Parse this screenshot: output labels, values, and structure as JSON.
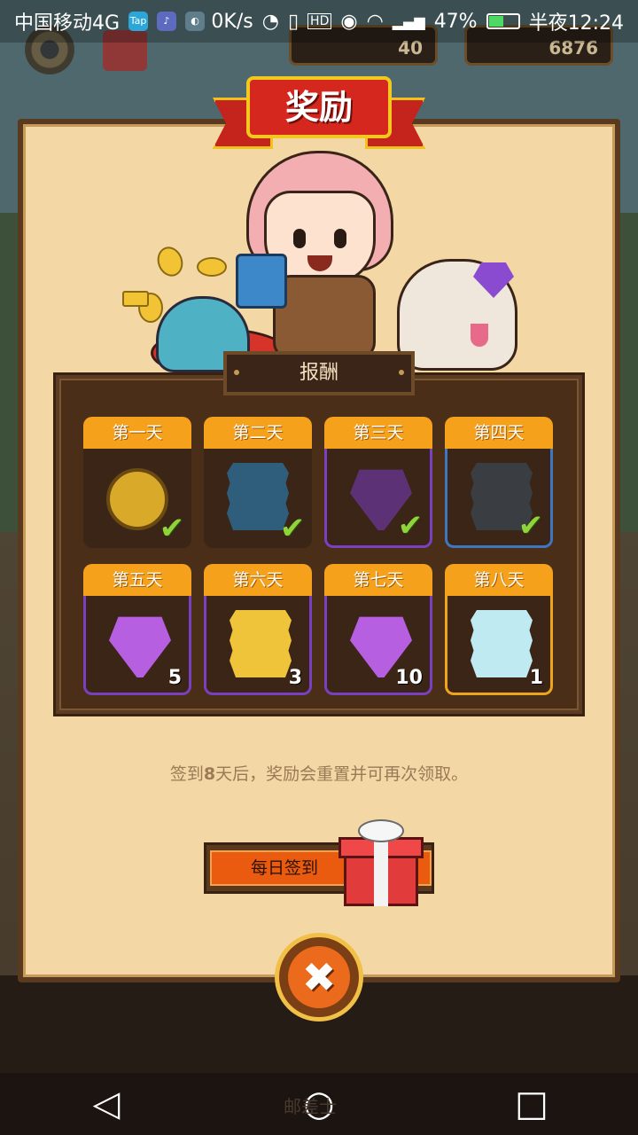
{
  "status_bar": {
    "carrier": "中国移动4G",
    "speed": "0K/s",
    "battery_percent": "47%",
    "time": "半夜12:24",
    "icons": [
      "tap-icon",
      "music-icon",
      "app-icon",
      "nfc-icon",
      "vibrate-icon",
      "hd-icon",
      "eye-icon",
      "wifi-icon",
      "4g-signal-icon",
      "battery-icon"
    ]
  },
  "hud": {
    "gem_count": "40",
    "coin_count": "6876"
  },
  "dialog": {
    "title": "奖励",
    "section_title": "报酬",
    "days": [
      {
        "label": "第一天",
        "item": "coin",
        "claimed": true
      },
      {
        "label": "第二天",
        "item": "blue-card",
        "claimed": true
      },
      {
        "label": "第三天",
        "item": "dark-gem",
        "claimed": true
      },
      {
        "label": "第四天",
        "item": "dark-card",
        "claimed": true
      },
      {
        "label": "第五天",
        "item": "purple-gem",
        "quantity": "5"
      },
      {
        "label": "第六天",
        "item": "gold-card",
        "quantity": "3"
      },
      {
        "label": "第七天",
        "item": "purple-gem",
        "quantity": "10"
      },
      {
        "label": "第八天",
        "item": "ice-card",
        "quantity": "1"
      }
    ],
    "note_before": "签到",
    "note_bold": "8",
    "note_after": "天后，奖励会重置并可再次领取。",
    "sign_in_label": "每日签到",
    "close_symbol": "✖"
  },
  "nav": {
    "back": "◁",
    "home": "○",
    "recent": "□",
    "faded_label": "邮差士"
  },
  "colors": {
    "panel": "#f3d7a4",
    "tab_orange": "#f6a11c",
    "accent_red": "#d6271f",
    "check_green": "#8fd43a"
  }
}
